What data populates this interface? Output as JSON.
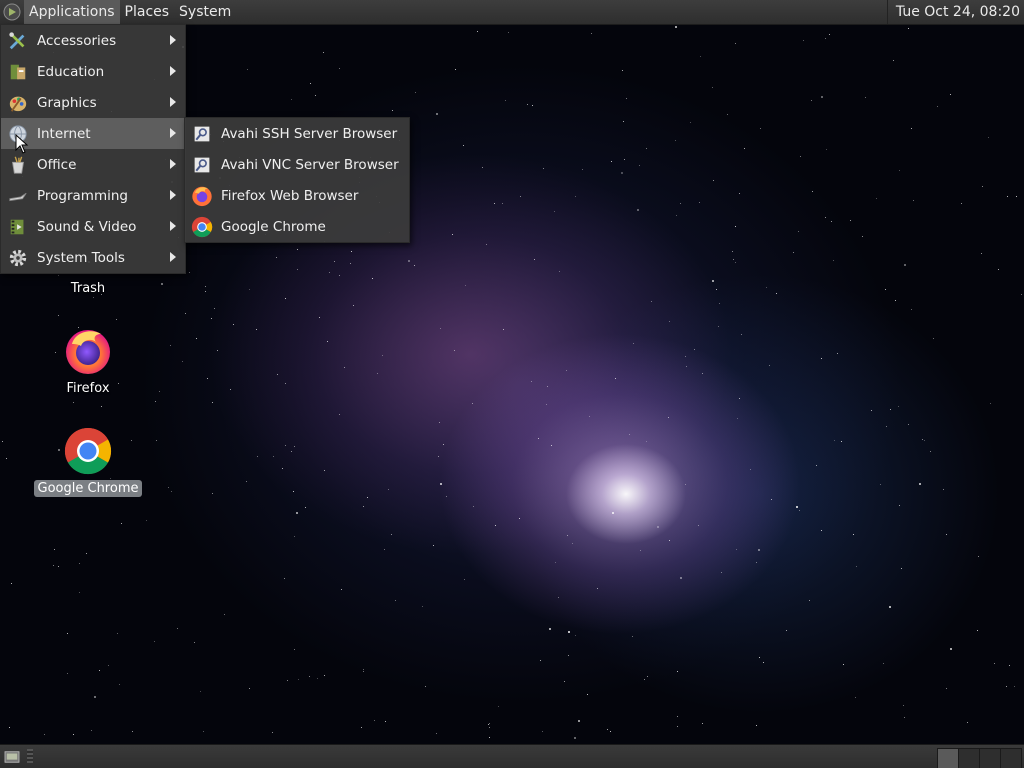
{
  "top_panel": {
    "menus": [
      "Applications",
      "Places",
      "System"
    ],
    "clock": "Tue Oct 24, 08:20"
  },
  "applications_menu": {
    "items": [
      {
        "label": "Accessories",
        "icon": "accessories-icon"
      },
      {
        "label": "Education",
        "icon": "education-icon"
      },
      {
        "label": "Graphics",
        "icon": "graphics-icon"
      },
      {
        "label": "Internet",
        "icon": "internet-globe-icon"
      },
      {
        "label": "Office",
        "icon": "office-icon"
      },
      {
        "label": "Programming",
        "icon": "programming-icon"
      },
      {
        "label": "Sound & Video",
        "icon": "sound-video-icon"
      },
      {
        "label": "System Tools",
        "icon": "system-tools-gear-icon"
      }
    ],
    "active_item": "Internet"
  },
  "internet_submenu": {
    "items": [
      {
        "label": "Avahi SSH Server Browser",
        "icon": "avahi-search-icon"
      },
      {
        "label": "Avahi VNC Server Browser",
        "icon": "avahi-search-icon"
      },
      {
        "label": "Firefox Web Browser",
        "icon": "firefox-icon"
      },
      {
        "label": "Google Chrome",
        "icon": "chrome-icon"
      }
    ]
  },
  "desktop": {
    "icons": [
      {
        "label": "Trash",
        "icon": "trash-icon"
      },
      {
        "label": "Firefox",
        "icon": "firefox-icon"
      },
      {
        "label": "Google Chrome",
        "icon": "chrome-icon",
        "selected": true
      }
    ]
  },
  "colors": {
    "panel": "#333333",
    "menu_bg": "#3c3c3c",
    "menu_hover": "#5e5e5e",
    "selected_label": "#7b7f84"
  }
}
